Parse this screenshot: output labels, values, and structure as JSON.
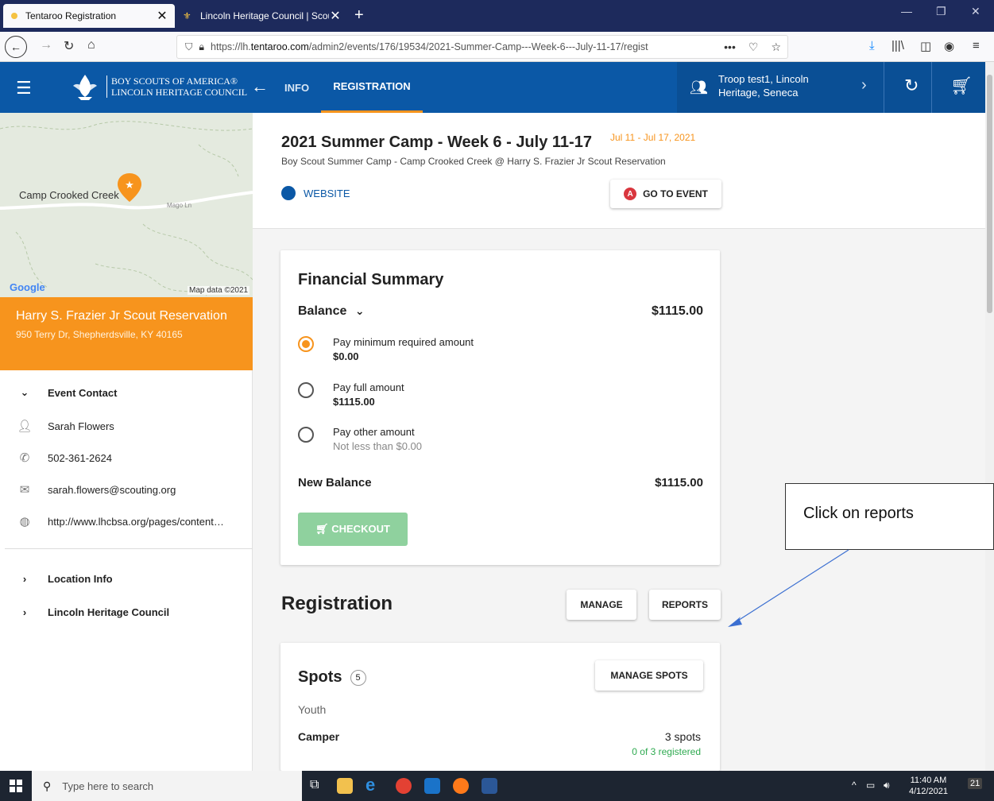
{
  "browser": {
    "tabs": [
      {
        "title": "Tentaroo Registration",
        "active": true
      },
      {
        "title": "Lincoln Heritage Council | Scou",
        "active": false
      }
    ],
    "url_prefix": "https://lh.",
    "url_domain": "tentaroo.com",
    "url_path": "/admin2/events/176/19534/2021-Summer-Camp---Week-6---July-11-17/regist",
    "url_dots": "•••"
  },
  "header": {
    "org_line1": "BOY SCOUTS OF AMERICA®",
    "org_line2": "LINCOLN HERITAGE COUNCIL",
    "tab_info": "INFO",
    "tab_registration": "REGISTRATION",
    "troop": "Troop test1, Lincoln Heritage, Seneca"
  },
  "map": {
    "label": "Camp Crooked Creek",
    "road": "Mago Ln",
    "google": "Google",
    "attribution": "Map data ©2021"
  },
  "venue": {
    "name": "Harry S. Frazier Jr Scout Reservation",
    "address": "950 Terry Dr, Shepherdsville, KY 40165"
  },
  "sidebar": {
    "event_contact": "Event Contact",
    "contact_name": "Sarah Flowers",
    "contact_phone": "502-361-2624",
    "contact_email": "sarah.flowers@scouting.org",
    "contact_url": "http://www.lhcbsa.org/pages/content…",
    "location_info": "Location Info",
    "council": "Lincoln Heritage Council"
  },
  "event": {
    "title": "2021 Summer Camp - Week 6 - July 11-17",
    "dates": "Jul 11 - Jul 17, 2021",
    "subtitle": "Boy Scout Summer Camp - Camp Crooked Creek @ Harry S. Frazier Jr Scout Reservation",
    "website": "WEBSITE",
    "go_to_event": "GO TO EVENT",
    "badge": "A"
  },
  "financial": {
    "title": "Financial Summary",
    "balance_label": "Balance",
    "balance": "$1115.00",
    "options": [
      {
        "label": "Pay minimum required amount",
        "amount": "$0.00",
        "selected": true
      },
      {
        "label": "Pay full amount",
        "amount": "$1115.00",
        "selected": false
      },
      {
        "label": "Pay other amount",
        "note": "Not less than $0.00",
        "selected": false
      }
    ],
    "new_balance_label": "New Balance",
    "new_balance": "$1115.00",
    "checkout": "CHECKOUT"
  },
  "registration": {
    "title": "Registration",
    "manage": "MANAGE",
    "reports": "REPORTS"
  },
  "spots": {
    "title": "Spots",
    "count": "5",
    "manage_spots": "MANAGE SPOTS",
    "group": "Youth",
    "camper": "Camper",
    "camper_spots": "3 spots",
    "camper_registered": "0 of 3 registered"
  },
  "annotation": {
    "text": "Click on reports"
  },
  "taskbar": {
    "search_placeholder": "Type here to search",
    "time": "11:40 AM",
    "date": "4/12/2021",
    "notifications": "21"
  },
  "colors": {
    "brand_blue": "#0b58a6",
    "accent_orange": "#f7941d",
    "success_green": "#2eaa50"
  }
}
